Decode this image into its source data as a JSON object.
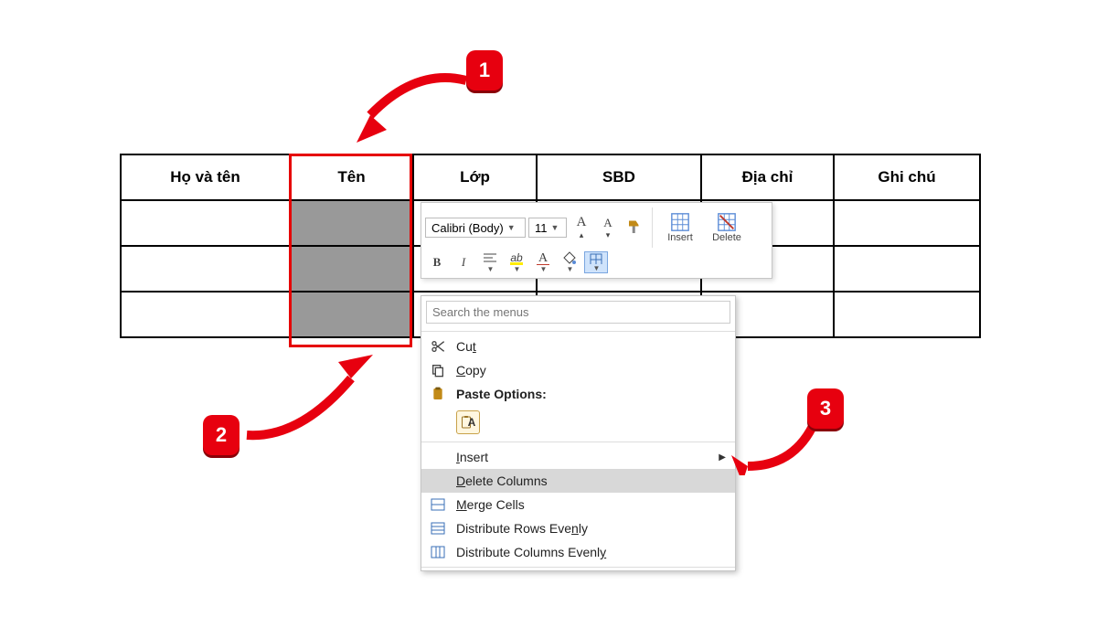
{
  "table": {
    "headers": [
      "Họ và tên",
      "Tên",
      "Lớp",
      "SBD",
      "Địa chỉ",
      "Ghi chú"
    ]
  },
  "mini": {
    "font_name": "Calibri (Body)",
    "font_size": "11",
    "insert_label": "Insert",
    "delete_label": "Delete",
    "bold": "B",
    "italic": "I"
  },
  "ctx": {
    "search_placeholder": "Search the menus",
    "cut": "Cut",
    "copy": "Copy",
    "paste_options": "Paste Options:",
    "insert": "Insert",
    "delete_columns": "Delete Columns",
    "merge_cells": "Merge Cells",
    "dist_rows": "Distribute Rows Evenly",
    "dist_cols": "Distribute Columns Evenly"
  },
  "steps": {
    "one": "1",
    "two": "2",
    "three": "3"
  }
}
